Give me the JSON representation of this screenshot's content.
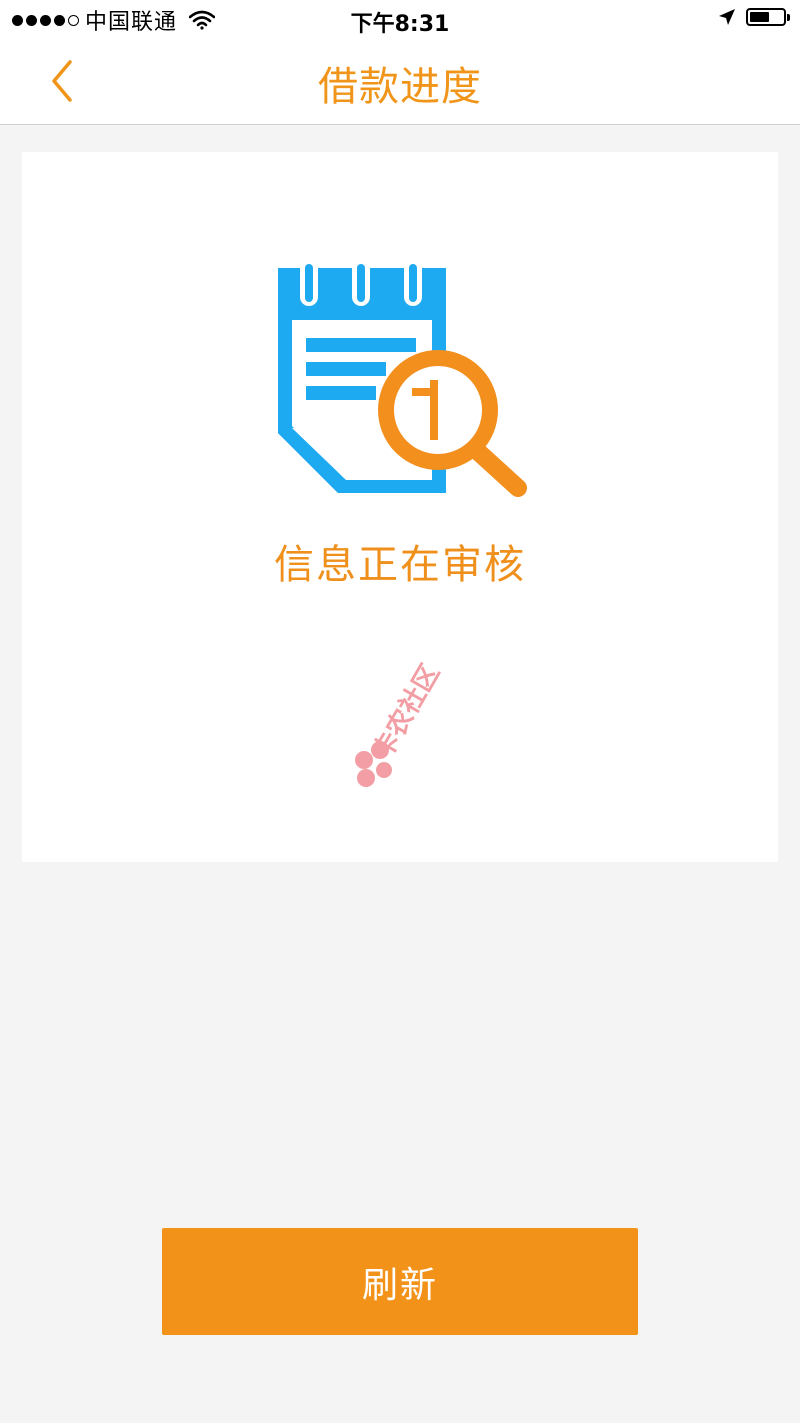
{
  "status_bar": {
    "carrier": "中国联通",
    "time": "下午8:31",
    "signal_bars_filled": 4,
    "signal_bars_total": 5,
    "battery_level": 0.6,
    "icons": [
      "wifi-icon",
      "location-arrow-icon",
      "battery-icon"
    ]
  },
  "nav": {
    "title": "借款进度",
    "back_icon": "chevron-left-icon"
  },
  "card": {
    "icon": "document-review-icon",
    "status_text": "信息正在审核",
    "watermark_text": "卡农社区"
  },
  "actions": {
    "refresh_label": "刷新"
  },
  "colors": {
    "accent": "#f39219",
    "title_orange": "#f1951a",
    "icon_blue": "#1eaaf1",
    "icon_orange": "#f28f1d",
    "background": "#f4f4f4",
    "card_bg": "#ffffff",
    "watermark_red": "#e8505b"
  }
}
